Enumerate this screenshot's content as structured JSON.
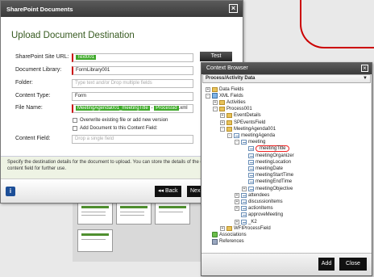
{
  "upload": {
    "title": "SharePoint Documents",
    "heading": "Upload Document Destination",
    "fields": {
      "site_url_label": "SharePoint Site URL:",
      "site_url_value": "Text001",
      "test_button": "Test",
      "library_label": "Document Library:",
      "library_value": "FormLibrary001",
      "folder_label": "Folder:",
      "folder_placeholder": "Type text and/or Drop multiple fields",
      "content_type_label": "Content Type:",
      "content_type_value": "Form",
      "file_name_label": "File Name:",
      "file_name_part1": "MeetingAgenda001_meetingTitle",
      "file_name_sep": "-",
      "file_name_part2": "Processid",
      "file_name_ext": ".xml",
      "overwrite_label": "Overwrite existing file or add new version",
      "add_to_cf_label": "Add Document to this Content Field:",
      "content_field_label": "Content Field:",
      "content_field_placeholder": "Drop a single field"
    },
    "footer_text_1": "Specify the destination details for the document to upload. You can store the details of the d",
    "footer_text_2": "content field for further use.",
    "back_button": "Back",
    "next_button": "Nex"
  },
  "context_browser": {
    "title": "Context Browser",
    "dropdown": "Process/Activity Data",
    "tree": [
      {
        "label": "Data Fields",
        "icon": "folder-icon",
        "expander": "+",
        "depth": 1
      },
      {
        "label": "XML Fields",
        "icon": "xml-icon",
        "expander": "-",
        "depth": 1
      },
      {
        "label": "Activities",
        "icon": "folder-icon",
        "expander": "+",
        "depth": 2
      },
      {
        "label": "Process001",
        "icon": "folder-icon",
        "expander": "-",
        "depth": 2
      },
      {
        "label": "EventDetails",
        "icon": "folder-icon",
        "expander": "+",
        "depth": 3
      },
      {
        "label": "SPEventsField",
        "icon": "folder-icon",
        "expander": "+",
        "depth": 3
      },
      {
        "label": "MeetingAgenda001",
        "icon": "folder-icon",
        "expander": "-",
        "depth": 3
      },
      {
        "label": "meetingAgenda",
        "icon": "field-icon",
        "expander": "-",
        "depth": 4
      },
      {
        "label": "meeting",
        "icon": "field-icon",
        "expander": "-",
        "depth": 5
      },
      {
        "label": "meetingTitle",
        "icon": "field-icon",
        "expander": "",
        "depth": 6,
        "highlight": true
      },
      {
        "label": "meetingOrganizer",
        "icon": "field-icon",
        "expander": "",
        "depth": 6
      },
      {
        "label": "meetingLocation",
        "icon": "field-icon",
        "expander": "",
        "depth": 6
      },
      {
        "label": "meetingDate",
        "icon": "field-icon",
        "expander": "",
        "depth": 6
      },
      {
        "label": "meetingStartTime",
        "icon": "field-icon",
        "expander": "",
        "depth": 6
      },
      {
        "label": "meetingEndTime",
        "icon": "field-icon",
        "expander": "",
        "depth": 6
      },
      {
        "label": "meetingObjective",
        "icon": "field-icon",
        "expander": "+",
        "depth": 6
      },
      {
        "label": "attendees",
        "icon": "field-icon",
        "expander": "+",
        "depth": 5
      },
      {
        "label": "discussionItems",
        "icon": "field-icon",
        "expander": "+",
        "depth": 5
      },
      {
        "label": "actionItems",
        "icon": "field-icon",
        "expander": "+",
        "depth": 5
      },
      {
        "label": "approveMeeting",
        "icon": "field-icon",
        "expander": "",
        "depth": 5
      },
      {
        "label": "_K2",
        "icon": "field-icon",
        "expander": "+",
        "depth": 5
      },
      {
        "label": "WFIProcessField",
        "icon": "folder-icon",
        "expander": "+",
        "depth": 3
      },
      {
        "label": "Associations",
        "icon": "associations-icon",
        "expander": "",
        "depth": 1
      },
      {
        "label": "References",
        "icon": "references-icon",
        "expander": "",
        "depth": 1
      }
    ],
    "add_button": "Add",
    "close_button": "Close"
  },
  "colors": {
    "accent_green": "#3faa2a",
    "highlight_circle": "#e22",
    "titlebar": "#444444"
  }
}
